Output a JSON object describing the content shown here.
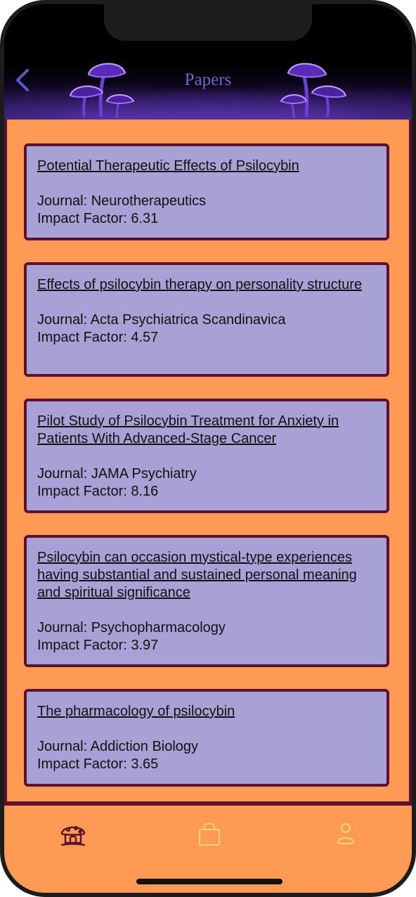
{
  "header": {
    "title": "Papers",
    "back_icon": "chevron-left-icon",
    "decoration_icon": "mushroom-icon"
  },
  "colors": {
    "background": "#ff9a55",
    "card": "#a8a1d6",
    "card_border": "#5a1230",
    "title": "#6f64c8",
    "back": "#5b58c8"
  },
  "papers": [
    {
      "title": "Potential Therapeutic Effects of Psilocybin",
      "journal": "Journal: Neurotherapeutics",
      "impact": "Impact Factor: 6.31"
    },
    {
      "title": "Effects of psilocybin therapy on personality structure",
      "journal": "Journal: Acta Psychiatrica Scandinavica",
      "impact": "Impact Factor: 4.57"
    },
    {
      "title": "Pilot Study of Psilocybin Treatment for Anxiety in Patients With Advanced-Stage Cancer",
      "journal": "Journal: JAMA Psychiatry",
      "impact": "Impact Factor: 8.16"
    },
    {
      "title": "Psilocybin can occasion mystical-type experiences having substantial and sustained personal meaning and spiritual significance",
      "journal": "Journal: Psychopharmacology",
      "impact": "Impact Factor: 3.97"
    },
    {
      "title": "The pharmacology of psilocybin",
      "journal": "Journal: Addiction Biology",
      "impact": "Impact Factor: 3.65"
    }
  ],
  "tabbar": {
    "items": [
      {
        "icon": "mushroom-house-icon",
        "active": true
      },
      {
        "icon": "shopping-bag-icon",
        "active": false
      },
      {
        "icon": "profile-icon",
        "active": false
      }
    ]
  }
}
